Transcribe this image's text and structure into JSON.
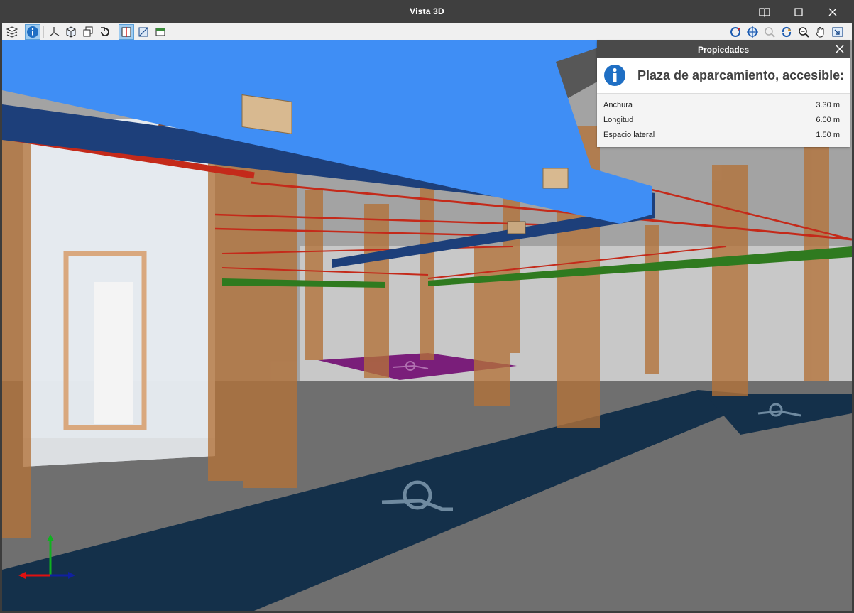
{
  "window": {
    "title": "Vista 3D",
    "controls": [
      "book-icon",
      "maximize-icon",
      "close-icon"
    ]
  },
  "toolbar": {
    "left_tools": [
      "layers-icon",
      "info-icon",
      "axes-icon",
      "cube-view-icon",
      "multi-view-icon",
      "rotate-reset-icon",
      "section-icon",
      "clip-plane-icon",
      "floor-plan-icon"
    ],
    "right_tools": [
      "orbit-icon",
      "zoom-extents-icon",
      "zoom-previous-icon",
      "refresh-icon",
      "zoom-window-icon",
      "pan-hand-icon",
      "fit-window-icon"
    ]
  },
  "properties_panel": {
    "header": "Propiedades",
    "element_name": "Plaza de aparcamiento, accesible:",
    "rows": [
      {
        "key": "Anchura",
        "value": "3.30 m"
      },
      {
        "key": "Longitud",
        "value": "6.00 m"
      },
      {
        "key": "Espacio lateral",
        "value": "1.50 m"
      }
    ]
  },
  "scene": {
    "colors": {
      "floor": "#6f6f6f",
      "parking_space": "#14304a",
      "accessible_space": "#7a1e7a",
      "column": "#b37238",
      "duct_blue": "#3f8ef5",
      "duct_dark": "#1d3f7a",
      "pipe_red": "#c42a1a",
      "green_beam": "#2f7a1f",
      "ceiling": "#9a9a9a"
    }
  },
  "axis_triad": {
    "x_color": "#e01010",
    "y_color": "#10b020",
    "z_color": "#1020a0"
  }
}
